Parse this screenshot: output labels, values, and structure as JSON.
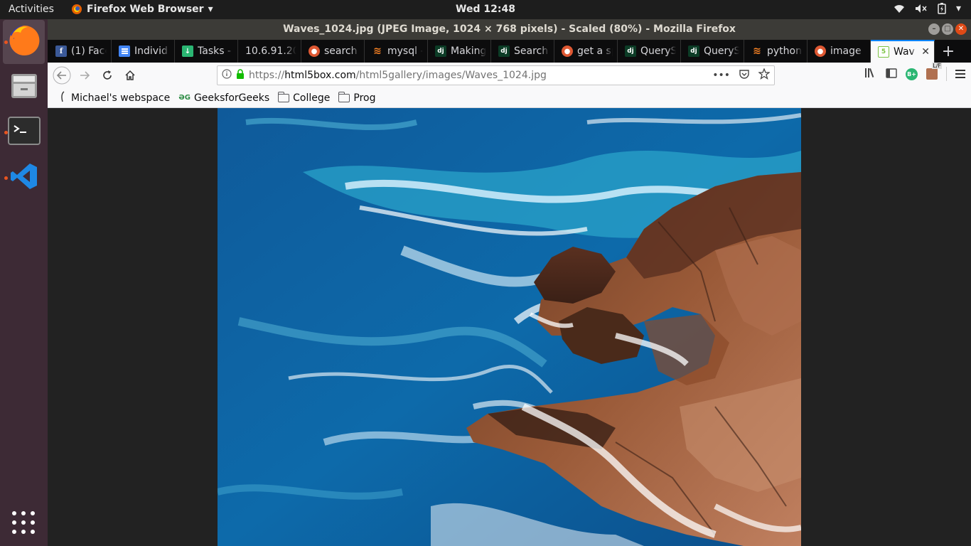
{
  "topbar": {
    "activities": "Activities",
    "app_name": "Firefox Web Browser",
    "clock": "Wed 12:48"
  },
  "dock": {
    "items": [
      "firefox",
      "files",
      "terminal",
      "vscode",
      "show-applications"
    ]
  },
  "window": {
    "title": "Waves_1024.jpg (JPEG Image, 1024 × 768 pixels) - Scaled (80%) - Mozilla Firefox"
  },
  "tabs": [
    {
      "label": "(1) Face",
      "icon": "facebook-icon"
    },
    {
      "label": "Individ",
      "icon": "docs-icon"
    },
    {
      "label": "Tasks -",
      "icon": "tasks-icon"
    },
    {
      "label": "10.6.91.20",
      "icon": "none"
    },
    {
      "label": "search",
      "icon": "duckduckgo-icon"
    },
    {
      "label": "mysql -",
      "icon": "stackoverflow-icon"
    },
    {
      "label": "Making",
      "icon": "django-icon"
    },
    {
      "label": "Search",
      "icon": "django-icon"
    },
    {
      "label": "get a sp",
      "icon": "duckduckgo-icon"
    },
    {
      "label": "QueryS",
      "icon": "django-icon"
    },
    {
      "label": "QueryS",
      "icon": "django-icon"
    },
    {
      "label": "python",
      "icon": "stackoverflow-icon"
    },
    {
      "label": "image",
      "icon": "duckduckgo-icon"
    },
    {
      "label": "Wav",
      "icon": "html5box-icon",
      "selected": true
    }
  ],
  "urlbar": {
    "prefix": "https://",
    "domain": "html5box.com",
    "path": "/html5gallery/images/Waves_1024.jpg"
  },
  "bookmarks": [
    {
      "label": "Michael's webspace",
      "icon": "page-icon"
    },
    {
      "label": "GeeksforGeeks",
      "icon": "gfg-icon"
    },
    {
      "label": "College",
      "icon": "folder-icon"
    },
    {
      "label": "Prog",
      "icon": "folder-icon"
    }
  ],
  "toolbar": {
    "addon_badge": "B+",
    "lf_badge": "L/F"
  }
}
